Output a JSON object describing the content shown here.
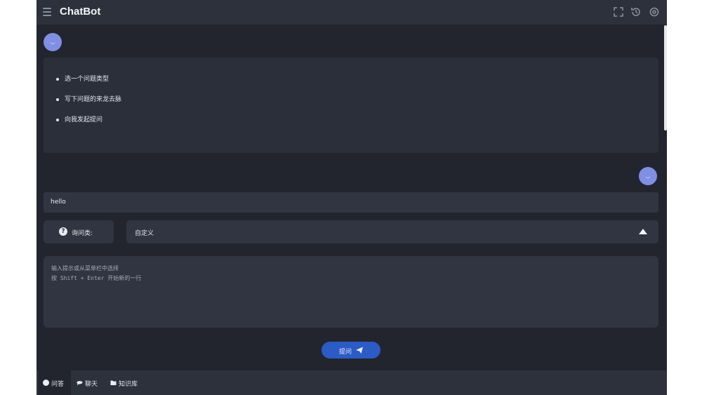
{
  "header": {
    "title": "ChatBot",
    "icons": [
      "menu-icon",
      "fullscreen-icon",
      "history-icon",
      "settings-icon"
    ]
  },
  "messages": [
    {
      "role": "bot",
      "items": [
        "选一个问题类型",
        "写下问题的来龙去脉",
        "向我发起提问"
      ]
    },
    {
      "role": "user",
      "text": "hello"
    }
  ],
  "question_type": {
    "label": "询问类:",
    "selected": "自定义"
  },
  "prompt": {
    "placeholder_line1": "输入提示或从菜单栏中选择",
    "placeholder_line2": "按 Shift + Enter 开始新的一行"
  },
  "submit": {
    "label": "提问"
  },
  "bottom_tabs": [
    {
      "label": "问答",
      "icon": "qa-icon",
      "active": true
    },
    {
      "label": "聊天",
      "icon": "chat-icon",
      "active": false
    },
    {
      "label": "知识库",
      "icon": "folder-icon",
      "active": false
    }
  ],
  "colors": {
    "background": "#22252e",
    "panel": "#2d313c",
    "accent": "#2b5bc4",
    "avatar": "#7f8fe3"
  }
}
